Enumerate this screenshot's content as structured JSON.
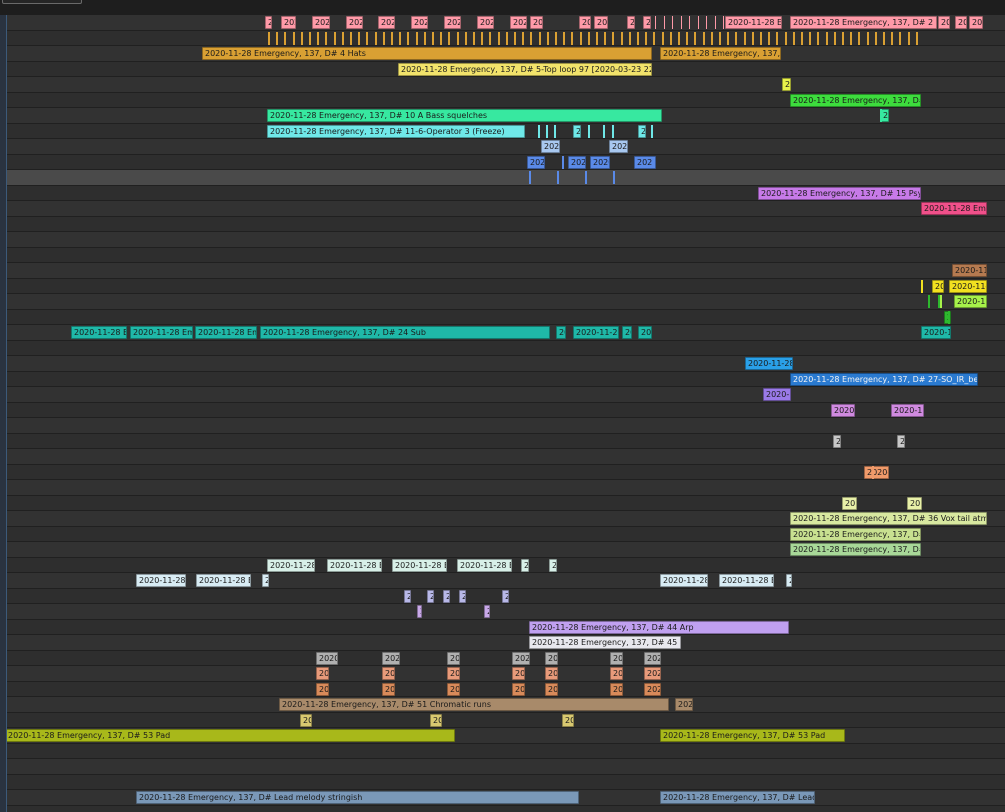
{
  "clip_name_prefix": "2020-11-28 Emergency, 137, D#",
  "clips": [
    {
      "lane": 0,
      "text": "2",
      "color": "#ff9aa8"
    },
    {
      "lane": 0,
      "text": "202",
      "color": "#ff9aa8"
    },
    {
      "lane": 0,
      "text": "202",
      "color": "#ff9aa8"
    },
    {
      "lane": 0,
      "text": "202",
      "color": "#ff9aa8"
    },
    {
      "lane": 0,
      "text": "202",
      "color": "#ff9aa8"
    },
    {
      "lane": 0,
      "text": "202",
      "color": "#ff9aa8"
    },
    {
      "lane": 0,
      "text": "202",
      "color": "#ff9aa8"
    },
    {
      "lane": 0,
      "text": "202",
      "color": "#ff9aa8"
    },
    {
      "lane": 0,
      "text": "202",
      "color": "#ff9aa8"
    },
    {
      "lane": 0,
      "text": "20",
      "color": "#ff9aa8"
    },
    {
      "lane": 0,
      "text": "20",
      "color": "#ff9aa8"
    },
    {
      "lane": 0,
      "text": "20",
      "color": "#ff9aa8"
    },
    {
      "lane": 0,
      "text": "2",
      "color": "#ff9aa8"
    },
    {
      "lane": 0,
      "text": "2",
      "color": "#ff9aa8"
    },
    {
      "lane": 0,
      "text": "2020-11-28 E",
      "color": "#ff9aa8"
    },
    {
      "lane": 0,
      "text": "2020-11-28 Emergency, 137, D# 2 K",
      "color": "#ff9aa8"
    },
    {
      "lane": 0,
      "text": "20",
      "color": "#ff9aa8"
    },
    {
      "lane": 0,
      "text": "20",
      "color": "#ff9aa8"
    },
    {
      "lane": 0,
      "text": "20",
      "color": "#ff9aa8"
    },
    {
      "lane": 2,
      "text": "2020-11-28 Emergency, 137, D# 4 Hats",
      "color": "#d9a033"
    },
    {
      "lane": 2,
      "text": "2020-11-28 Emergency, 137, D",
      "color": "#d9a033"
    },
    {
      "lane": 3,
      "text": "2020-11-28 Emergency, 137, D# 5-Top loop 97 [2020-03-23 2253",
      "color": "#f2e36b"
    },
    {
      "lane": 4,
      "text": "20",
      "color": "#e8f24a"
    },
    {
      "lane": 5,
      "text": "2020-11-28 Emergency, 137, D#",
      "color": "#3ddc3d"
    },
    {
      "lane": 6,
      "text": "2020-11-28 Emergency, 137, D# 10 A Bass squelches",
      "color": "#37e8a0"
    },
    {
      "lane": 6,
      "text": "2",
      "color": "#37e8a0"
    },
    {
      "lane": 7,
      "text": "2020-11-28 Emergency, 137, D# 11-6-Operator 3 (Freeze)",
      "color": "#6fe8e8"
    },
    {
      "lane": 7,
      "text": "2",
      "color": "#6fe8e8"
    },
    {
      "lane": 7,
      "text": "2",
      "color": "#6fe8e8"
    },
    {
      "lane": 8,
      "text": "202",
      "color": "#a8c8f0"
    },
    {
      "lane": 8,
      "text": "202",
      "color": "#a8c8f0"
    },
    {
      "lane": 9,
      "text": "202",
      "color": "#5a8ae8"
    },
    {
      "lane": 9,
      "text": "202",
      "color": "#5a8ae8"
    },
    {
      "lane": 9,
      "text": "2020",
      "color": "#5a8ae8"
    },
    {
      "lane": 9,
      "text": "202",
      "color": "#5a8ae8"
    },
    {
      "lane": 11,
      "text": "2020-11-28 Emergency, 137, D# 15 Psy b",
      "color": "#c77ae8"
    },
    {
      "lane": 12,
      "text": "2020-11-28 Eme",
      "color": "#f0508a"
    },
    {
      "lane": 16,
      "text": "2020-11",
      "color": "#b57a50"
    },
    {
      "lane": 17,
      "text": "20",
      "color": "#f2e020"
    },
    {
      "lane": 17,
      "text": "2020-11-",
      "color": "#f2e020"
    },
    {
      "lane": 18,
      "text": "2020-11",
      "color": "#a6f24a"
    },
    {
      "lane": 19,
      "text": "2",
      "color": "#2eb82e"
    },
    {
      "lane": 20,
      "text": "2020-11-28 E",
      "color": "#1fb8a8"
    },
    {
      "lane": 20,
      "text": "2020-11-28 Em",
      "color": "#1fb8a8"
    },
    {
      "lane": 20,
      "text": "2020-11-28 Em",
      "color": "#1fb8a8"
    },
    {
      "lane": 20,
      "text": "2020-11-28 Emergency, 137, D# 24 Sub",
      "color": "#1fb8a8"
    },
    {
      "lane": 20,
      "text": "20",
      "color": "#1fb8a8"
    },
    {
      "lane": 20,
      "text": "2020-11-2",
      "color": "#1fb8a8"
    },
    {
      "lane": 20,
      "text": "20",
      "color": "#1fb8a8"
    },
    {
      "lane": 20,
      "text": "202",
      "color": "#1fb8a8"
    },
    {
      "lane": 20,
      "text": "2020-1",
      "color": "#1fb8a8"
    },
    {
      "lane": 22,
      "text": "2020-11-28",
      "color": "#2aa0e8"
    },
    {
      "lane": 23,
      "text": "2020-11-28 Emergency, 137, D# 27-SO_IR_bell",
      "color": "#2a7ad0"
    },
    {
      "lane": 24,
      "text": "2020-1",
      "color": "#9a7ae8"
    },
    {
      "lane": 25,
      "text": "2020-",
      "color": "#d08ae0"
    },
    {
      "lane": 25,
      "text": "2020-11",
      "color": "#d08ae0"
    },
    {
      "lane": 27,
      "text": "2",
      "color": "#c8c8c8"
    },
    {
      "lane": 27,
      "text": "2",
      "color": "#c8c8c8"
    },
    {
      "lane": 29,
      "text": "2020-",
      "color": "#f09a6a"
    },
    {
      "lane": 31,
      "text": "20",
      "color": "#e8f0a8"
    },
    {
      "lane": 31,
      "text": "20",
      "color": "#e8f0a8"
    },
    {
      "lane": 32,
      "text": "2020-11-28 Emergency, 137, D# 36 Vox tail atmo",
      "color": "#d8e8a0"
    },
    {
      "lane": 33,
      "text": "2020-11-28 Emergency, 137, D#",
      "color": "#c8e090"
    },
    {
      "lane": 34,
      "text": "2020-11-28 Emergency, 137, D#",
      "color": "#a8d898"
    },
    {
      "lane": 35,
      "text": "2020-11-28",
      "color": "#d8f0e8"
    },
    {
      "lane": 35,
      "text": "2020-11-28 E",
      "color": "#d8f0e8"
    },
    {
      "lane": 35,
      "text": "2020-11-28 E",
      "color": "#d8f0e8"
    },
    {
      "lane": 35,
      "text": "2020-11-28 E",
      "color": "#d8f0e8"
    },
    {
      "lane": 35,
      "text": "2",
      "color": "#d8f0e8"
    },
    {
      "lane": 35,
      "text": "2",
      "color": "#d8f0e8"
    },
    {
      "lane": 36,
      "text": "2020-11-28",
      "color": "#d8ecf4"
    },
    {
      "lane": 36,
      "text": "2020-11-28 E",
      "color": "#d8ecf4"
    },
    {
      "lane": 36,
      "text": "2",
      "color": "#d8ecf4"
    },
    {
      "lane": 36,
      "text": "2020-11-28",
      "color": "#d8ecf4"
    },
    {
      "lane": 36,
      "text": "2020-11-28 E",
      "color": "#d8ecf4"
    },
    {
      "lane": 36,
      "text": "2",
      "color": "#d8ecf4"
    },
    {
      "lane": 37,
      "text": "2",
      "color": "#b8b8e8"
    },
    {
      "lane": 37,
      "text": "2",
      "color": "#b8b8e8"
    },
    {
      "lane": 37,
      "text": "2",
      "color": "#b8b8e8"
    },
    {
      "lane": 37,
      "text": "2",
      "color": "#b8b8e8"
    },
    {
      "lane": 37,
      "text": "2",
      "color": "#b8b8e8"
    },
    {
      "lane": 38,
      "text": "2",
      "color": "#c8a8e8"
    },
    {
      "lane": 38,
      "text": "2",
      "color": "#c8a8e8"
    },
    {
      "lane": 39,
      "text": "2020-11-28 Emergency, 137, D# 44 Arp",
      "color": "#c0a0f0"
    },
    {
      "lane": 40,
      "text": "2020-11-28 Emergency, 137, D# 45 Le",
      "color": "#e8e8ee"
    },
    {
      "lane": 41,
      "text": "2020",
      "color": "#b0b0b0"
    },
    {
      "lane": 41,
      "text": "202",
      "color": "#b0b0b0"
    },
    {
      "lane": 41,
      "text": "20",
      "color": "#b0b0b0"
    },
    {
      "lane": 41,
      "text": "202",
      "color": "#b0b0b0"
    },
    {
      "lane": 41,
      "text": "20",
      "color": "#b0b0b0"
    },
    {
      "lane": 41,
      "text": "20",
      "color": "#b0b0b0"
    },
    {
      "lane": 41,
      "text": "202",
      "color": "#b0b0b0"
    },
    {
      "lane": 42,
      "text": "20",
      "color": "#e89a7a"
    },
    {
      "lane": 42,
      "text": "20",
      "color": "#e89a7a"
    },
    {
      "lane": 42,
      "text": "20",
      "color": "#e89a7a"
    },
    {
      "lane": 42,
      "text": "20",
      "color": "#e89a7a"
    },
    {
      "lane": 42,
      "text": "20",
      "color": "#e89a7a"
    },
    {
      "lane": 42,
      "text": "20",
      "color": "#e89a7a"
    },
    {
      "lane": 42,
      "text": "202",
      "color": "#e89a7a"
    },
    {
      "lane": 43,
      "text": "20",
      "color": "#d88a5a"
    },
    {
      "lane": 43,
      "text": "20",
      "color": "#d88a5a"
    },
    {
      "lane": 43,
      "text": "20",
      "color": "#d88a5a"
    },
    {
      "lane": 43,
      "text": "20",
      "color": "#d88a5a"
    },
    {
      "lane": 43,
      "text": "20",
      "color": "#d88a5a"
    },
    {
      "lane": 43,
      "text": "20",
      "color": "#d88a5a"
    },
    {
      "lane": 43,
      "text": "202",
      "color": "#d88a5a"
    },
    {
      "lane": 44,
      "text": "2020-11-28 Emergency, 137, D# 51 Chromatic runs",
      "color": "#a88a6a"
    },
    {
      "lane": 44,
      "text": "2020",
      "color": "#a88a6a"
    },
    {
      "lane": 45,
      "text": "20",
      "color": "#d8c870"
    },
    {
      "lane": 45,
      "text": "20",
      "color": "#d8c870"
    },
    {
      "lane": 45,
      "text": "20",
      "color": "#d8c870"
    },
    {
      "lane": 46,
      "text": "2020-11-28 Emergency, 137, D# 53 Pad",
      "color": "#a8b81a"
    },
    {
      "lane": 46,
      "text": "2020-11-28 Emergency, 137, D# 53 Pad",
      "color": "#a8b81a"
    },
    {
      "lane": 50,
      "text": "2020-11-28 Emergency, 137, D# Lead melody stringish",
      "color": "#7a98b8"
    },
    {
      "lane": 50,
      "text": "2020-11-28 Emergency, 137, D# Lead n",
      "color": "#7a98b8"
    }
  ],
  "ticks": [
    {
      "lane": 1,
      "color": "#d9a033"
    },
    {
      "lane": 0,
      "color": "#ff9aa8"
    },
    {
      "lane": 7,
      "color": "#6fe8e8"
    },
    {
      "lane": 10,
      "color": "#5a8ae8"
    },
    {
      "lane": 18,
      "color": "#2eb82e"
    },
    {
      "lane": 29,
      "color": "#f09a6a"
    }
  ]
}
